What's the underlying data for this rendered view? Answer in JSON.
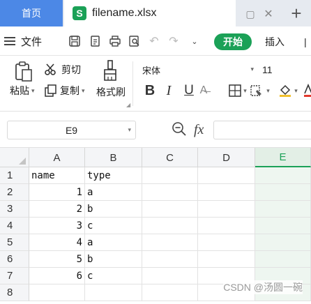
{
  "tabs": {
    "home_label": "首页",
    "file_label": "filename.xlsx",
    "file_logo": "S"
  },
  "menu": {
    "file_label": "文件",
    "start_label": "开始",
    "insert_label": "插入"
  },
  "ribbon": {
    "paste_label": "粘贴",
    "cut_label": "剪切",
    "copy_label": "复制",
    "format_painter_label": "格式刷",
    "font_name": "宋体",
    "font_size": "11"
  },
  "formula_bar": {
    "cell_ref": "E9",
    "fx_label": "fx",
    "formula_value": ""
  },
  "sheet": {
    "columns": [
      "A",
      "B",
      "C",
      "D",
      "E"
    ],
    "active_column": "E",
    "rows": [
      {
        "num": "1",
        "a": "name",
        "b": "type"
      },
      {
        "num": "2",
        "a": "1",
        "b": "a"
      },
      {
        "num": "3",
        "a": "2",
        "b": "b"
      },
      {
        "num": "4",
        "a": "3",
        "b": "c"
      },
      {
        "num": "5",
        "a": "4",
        "b": "a"
      },
      {
        "num": "6",
        "a": "5",
        "b": "b"
      },
      {
        "num": "7",
        "a": "6",
        "b": "c"
      },
      {
        "num": "8",
        "a": "",
        "b": ""
      }
    ]
  },
  "watermark": "CSDN @汤圆一碗",
  "colors": {
    "accent": "#1ba157",
    "home_tab": "#4c88e6"
  }
}
